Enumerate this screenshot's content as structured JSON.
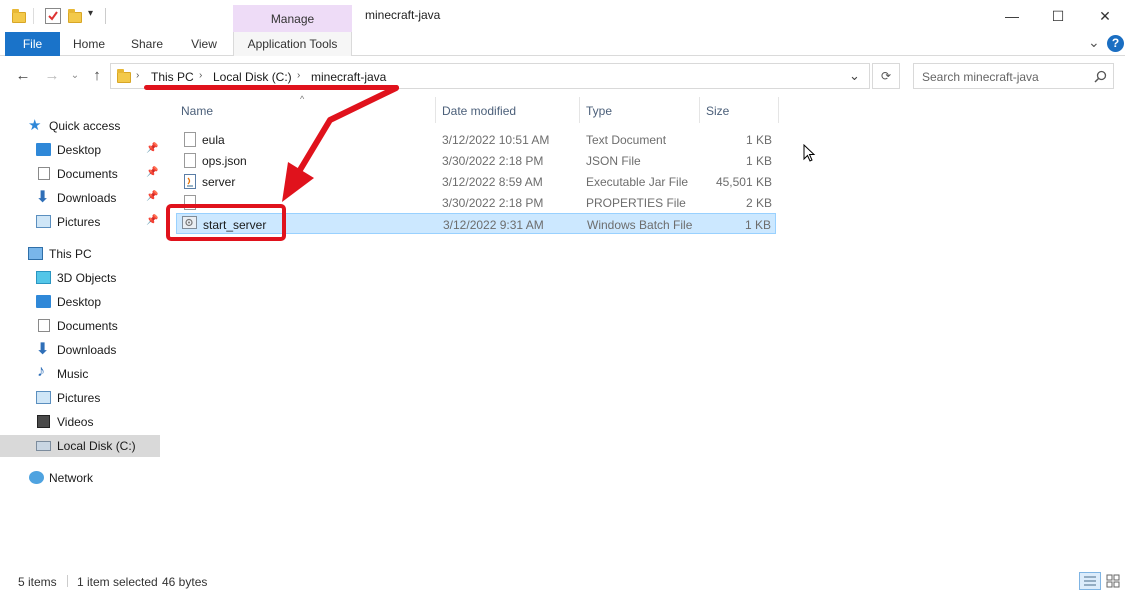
{
  "titlebar": {
    "manage_label": "Manage",
    "window_title": "minecraft-java",
    "minimize": "—",
    "maximize": "☐",
    "close": "✕"
  },
  "ribbon": {
    "tabs": [
      {
        "label": "File"
      },
      {
        "label": "Home"
      },
      {
        "label": "Share"
      },
      {
        "label": "View"
      },
      {
        "label": "Application Tools"
      }
    ],
    "chevron": "⌄",
    "help": "?"
  },
  "address": {
    "crumbs": [
      "This PC",
      "Local Disk (C:)",
      "minecraft-java"
    ],
    "search_placeholder": "Search minecraft-java"
  },
  "sidebar": {
    "items": [
      {
        "label": "Quick access",
        "icon": "star-icon"
      },
      {
        "label": "Desktop",
        "icon": "desktop-icon",
        "pinned": true
      },
      {
        "label": "Documents",
        "icon": "documents-icon",
        "pinned": true
      },
      {
        "label": "Downloads",
        "icon": "downloads-icon",
        "pinned": true
      },
      {
        "label": "Pictures",
        "icon": "pictures-icon",
        "pinned": true
      },
      {
        "label": "This PC",
        "icon": "computer-icon"
      },
      {
        "label": "3D Objects",
        "icon": "3d-objects-icon"
      },
      {
        "label": "Desktop",
        "icon": "desktop-icon"
      },
      {
        "label": "Documents",
        "icon": "documents-icon"
      },
      {
        "label": "Downloads",
        "icon": "downloads-icon"
      },
      {
        "label": "Music",
        "icon": "music-icon"
      },
      {
        "label": "Pictures",
        "icon": "pictures-icon"
      },
      {
        "label": "Videos",
        "icon": "videos-icon"
      },
      {
        "label": "Local Disk (C:)",
        "icon": "disk-icon",
        "selected": true
      },
      {
        "label": "Network",
        "icon": "network-icon"
      }
    ]
  },
  "columns": {
    "name": "Name",
    "date": "Date modified",
    "type": "Type",
    "size": "Size"
  },
  "files": [
    {
      "name": "eula",
      "date": "3/12/2022 10:51 AM",
      "type": "Text Document",
      "size": "1 KB"
    },
    {
      "name": "ops.json",
      "date": "3/30/2022 2:18 PM",
      "type": "JSON File",
      "size": "1 KB"
    },
    {
      "name": "server",
      "date": "3/12/2022 8:59 AM",
      "type": "Executable Jar File",
      "size": "45,501 KB"
    },
    {
      "name": "",
      "date": "3/30/2022 2:18 PM",
      "type": "PROPERTIES File",
      "size": "2 KB"
    },
    {
      "name": "start_server",
      "date": "3/12/2022 9:31 AM",
      "type": "Windows Batch File",
      "size": "1 KB",
      "selected": true
    }
  ],
  "status": {
    "items": "5 items",
    "selected": "1 item selected",
    "size": "46 bytes"
  },
  "colors": {
    "file_tab": "#1a73c9",
    "manage_tab": "#eedcf7",
    "selection": "#cce8ff",
    "annotation": "#e0121c"
  }
}
